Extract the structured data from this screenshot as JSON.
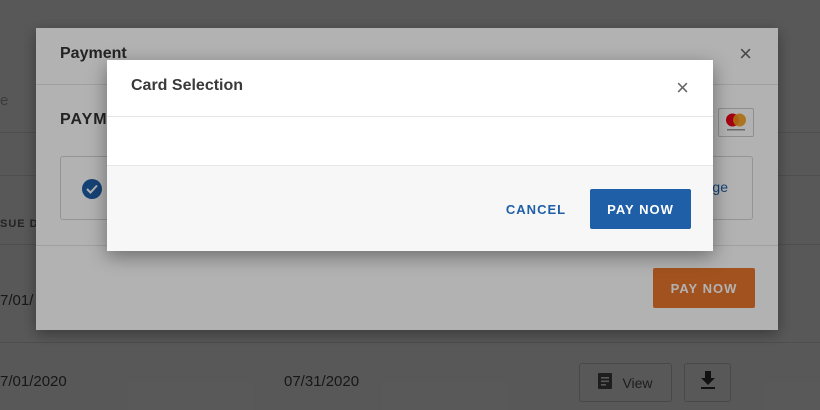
{
  "background": {
    "search_placeholder_fragment": "e",
    "column_header_fragment": "SUE D",
    "row1_date_fragment": "7/01/",
    "row2": {
      "issue_date_fragment": "7/01/2020",
      "due_date": "07/31/2020",
      "view_label": "View"
    }
  },
  "payment_modal": {
    "title": "Payment",
    "close_symbol": "×",
    "section_title_fragment": "PAYM",
    "change_link_fragment": "ge",
    "pay_now_label": "PAY NOW",
    "accent_color": "#e8762c"
  },
  "card_selection_modal": {
    "title": "Card Selection",
    "close_symbol": "×",
    "cancel_label": "CANCEL",
    "pay_now_label": "PAY NOW",
    "primary_color": "#1f5fa8"
  },
  "icons": {
    "card_brand": "mastercard-icon",
    "selected": "check-circle-icon",
    "document": "document-icon",
    "download": "download-icon"
  }
}
